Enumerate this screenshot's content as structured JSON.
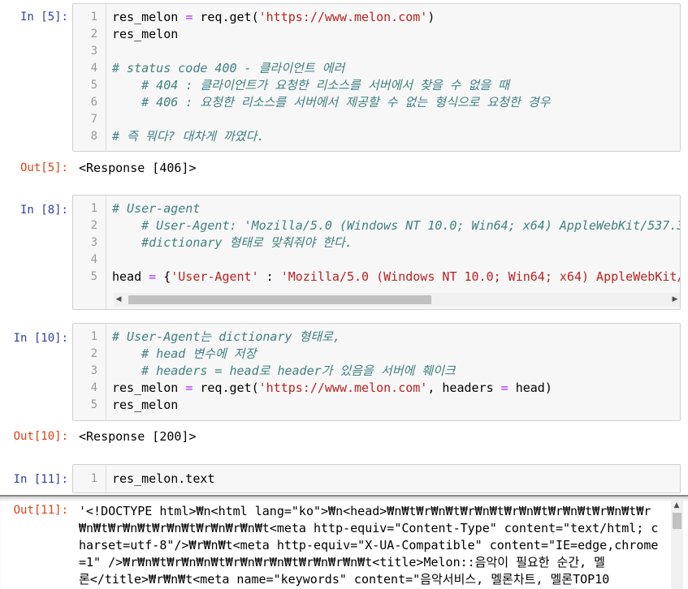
{
  "cells": [
    {
      "in_prompt": "In [5]:",
      "lines": [
        {
          "n": "1",
          "parts": [
            {
              "t": "res_melon ",
              "c": ""
            },
            {
              "t": "=",
              "c": "op"
            },
            {
              "t": " req.get(",
              "c": ""
            },
            {
              "t": "'https://www.melon.com'",
              "c": "str"
            },
            {
              "t": ")",
              "c": ""
            }
          ]
        },
        {
          "n": "2",
          "parts": [
            {
              "t": "res_melon",
              "c": ""
            }
          ]
        },
        {
          "n": "3",
          "parts": []
        },
        {
          "n": "4",
          "parts": [
            {
              "t": "# status code 400 - 클라이언트 에러",
              "c": "cm"
            }
          ]
        },
        {
          "n": "5",
          "parts": [
            {
              "t": "    # 404 : 클라이언트가 요청한 리소스를 서버에서 찾을 수 없을 때",
              "c": "cm"
            }
          ]
        },
        {
          "n": "6",
          "parts": [
            {
              "t": "    # 406 : 요청한 리소스를 서버에서 제공할 수 없는 형식으로 요청한 경우",
              "c": "cm"
            }
          ]
        },
        {
          "n": "7",
          "parts": []
        },
        {
          "n": "8",
          "parts": [
            {
              "t": "# 즉 뭐다? 대차게 까였다.",
              "c": "cm"
            }
          ]
        }
      ],
      "out_prompt": "Out[5]:",
      "output": "<Response [406]>"
    },
    {
      "in_prompt": "In [8]:",
      "lines": [
        {
          "n": "1",
          "parts": [
            {
              "t": "# User-agent",
              "c": "cm"
            }
          ]
        },
        {
          "n": "2",
          "parts": [
            {
              "t": "    # User-Agent: 'Mozilla/5.0 (Windows NT 10.0; Win64; x64) AppleWebKit/537.3",
              "c": "cm"
            }
          ]
        },
        {
          "n": "3",
          "parts": [
            {
              "t": "    #dictionary 형태로 맞춰줘야 한다.",
              "c": "cm"
            }
          ]
        },
        {
          "n": "4",
          "parts": []
        },
        {
          "n": "5",
          "parts": [
            {
              "t": "head ",
              "c": ""
            },
            {
              "t": "=",
              "c": "op"
            },
            {
              "t": " {",
              "c": ""
            },
            {
              "t": "'User-Agent'",
              "c": "str"
            },
            {
              "t": " : ",
              "c": ""
            },
            {
              "t": "'Mozilla/5.0 (Windows NT 10.0; Win64; x64) AppleWebKit/",
              "c": "str"
            }
          ]
        }
      ]
    },
    {
      "in_prompt": "In [10]:",
      "lines": [
        {
          "n": "1",
          "parts": [
            {
              "t": "# User-Agent는 dictionary 형태로,",
              "c": "cm"
            }
          ]
        },
        {
          "n": "2",
          "parts": [
            {
              "t": "    # head 변수에 저장",
              "c": "cm"
            }
          ]
        },
        {
          "n": "3",
          "parts": [
            {
              "t": "    # headers = head로 header가 있음을 서버에 훼이크",
              "c": "cm"
            }
          ]
        },
        {
          "n": "4",
          "parts": [
            {
              "t": "res_melon ",
              "c": ""
            },
            {
              "t": "=",
              "c": "op"
            },
            {
              "t": " req.get(",
              "c": ""
            },
            {
              "t": "'https://www.melon.com'",
              "c": "str"
            },
            {
              "t": ", headers ",
              "c": ""
            },
            {
              "t": "=",
              "c": "op"
            },
            {
              "t": " head)",
              "c": ""
            }
          ]
        },
        {
          "n": "5",
          "parts": [
            {
              "t": "res_melon",
              "c": ""
            }
          ]
        }
      ],
      "out_prompt": "Out[10]:",
      "output": "<Response [200]>"
    },
    {
      "in_prompt": "In [11]:",
      "lines": [
        {
          "n": "1",
          "parts": [
            {
              "t": "res_melon.text",
              "c": ""
            }
          ]
        }
      ],
      "out_prompt": "Out[11]:",
      "output_lines": [
        "'<!DOCTYPE html>₩n<html lang=\"ko\">₩n<head>₩n₩t₩r₩n₩t₩r₩n₩t₩r₩n₩t₩r₩n₩t₩r₩n₩t₩r",
        "₩n₩t₩r₩n₩t₩r₩n₩t₩r₩n₩r₩n₩t<meta http-equiv=\"Content-Type\" content=\"text/html; c",
        "harset=utf-8\"/>₩r₩n₩t<meta http-equiv=\"X-UA-Compatible\" content=\"IE=edge,chrome",
        "=1\" />₩r₩n₩t₩r₩n₩n₩t₩r₩n₩r₩n₩t₩r₩n₩r₩n₩t<title>Melon::음악이 필요한 순간, 멜",
        "론</title>₩r₩n₩t<meta name=\"keywords\" content=\"음악서비스, 멜론차트, 멜론TOP10"
      ]
    }
  ]
}
